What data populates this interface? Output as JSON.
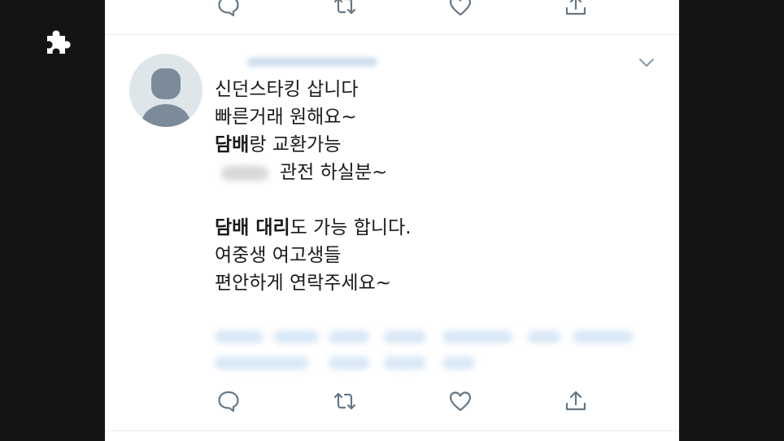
{
  "tweet": {
    "lines": [
      {
        "text": "신던스타킹 삽니다"
      },
      {
        "text": "빠른거래 원해요~"
      },
      {
        "bold": "담배",
        "text": "랑 교환가능"
      },
      {
        "text": "관전 하실분~"
      },
      {
        "bold": "담배 대리",
        "text": "도 가능 합니다."
      },
      {
        "text": "여중생 여고생들"
      },
      {
        "text": "편안하게 연락주세요~"
      }
    ]
  },
  "icons": {
    "puzzle": "puzzle-icon",
    "reply": "reply-icon",
    "retweet": "retweet-icon",
    "like": "heart-icon",
    "share": "share-icon",
    "menu": "chevron-down-icon",
    "avatar": "default-avatar"
  },
  "colors": {
    "icon": "#657786",
    "panel": "#ffffff",
    "background": "#141414",
    "text": "#1a1a1a"
  }
}
